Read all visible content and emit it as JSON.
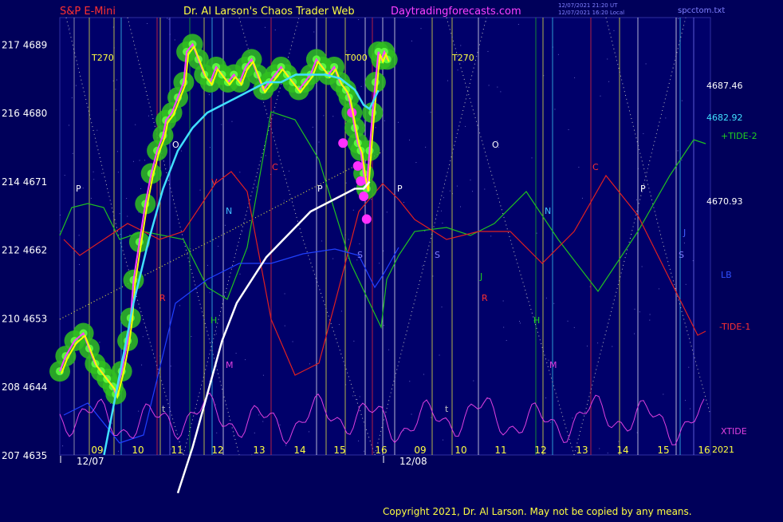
{
  "header": {
    "instrument": "S&P E-Mini",
    "site_title": "Dr. Al Larson's Chaos Trader Web",
    "site_url": "Daytradingforecasts.com",
    "timestamp_line1": "12/07/2021 21:20 UT",
    "timestamp_line2": "12/07/2021 16:20 Local",
    "file_name": "spcctom.txt"
  },
  "copyright": "Copyright 2021, Dr. Al Larson. May not be copied by any means.",
  "colors": {
    "background": "#00005a",
    "plot_bg": "#00006a",
    "header_red": "#ff3030",
    "header_yellow": "#ffff40",
    "header_magenta": "#ff40ff",
    "price": "#ffff00",
    "price_glow": "#30c020",
    "ma_cyan": "#40e0ff",
    "ma_white": "#ffffff",
    "tide_green": "#20c020",
    "tide_red": "#e02020",
    "lb_blue": "#2040ff",
    "xtide_magenta": "#e040e0"
  },
  "chart_data": {
    "type": "line",
    "x_labels": [
      "09",
      "10",
      "11",
      "12",
      "13",
      "14",
      "15",
      "16",
      "09",
      "10",
      "11",
      "12",
      "13",
      "14",
      "15",
      "16"
    ],
    "date_labels": [
      "12/07",
      "12/08"
    ],
    "y_ticks": [
      {
        "pair": "217 4689",
        "value": 4689
      },
      {
        "pair": "216 4680",
        "value": 4680
      },
      {
        "pair": "214 4671",
        "value": 4671
      },
      {
        "pair": "212 4662",
        "value": 4662
      },
      {
        "pair": "210 4653",
        "value": 4653
      },
      {
        "pair": "208 4644",
        "value": 4644
      },
      {
        "pair": "207 4635",
        "value": 4635
      }
    ],
    "ylim": [
      4635,
      4692.5
    ],
    "right_values": [
      {
        "label": "4687.46",
        "value": 4687.46,
        "color": "#ffffff"
      },
      {
        "label": "4682.92",
        "value": 4682.92,
        "color": "#40e0ff"
      },
      {
        "label": "4670.93",
        "value": 4670.93,
        "color": "#ffffff"
      }
    ],
    "legend_right": [
      {
        "label": "+TIDE-2",
        "color": "#20d020"
      },
      {
        "label": "LB",
        "color": "#3050ff"
      },
      {
        "label": "-TIDE-1",
        "color": "#ff3030"
      },
      {
        "label": "XTIDE",
        "color": "#e040e0"
      },
      {
        "label": "2021",
        "color": "#ffff40"
      }
    ],
    "markers": [
      {
        "text": "T270",
        "color": "#ffff40"
      },
      {
        "text": "T000",
        "color": "#ffff40"
      },
      {
        "text": "T270",
        "color": "#ffff40"
      },
      {
        "text": "P",
        "color": "#ffffff"
      },
      {
        "text": "O",
        "color": "#ffffff"
      },
      {
        "text": "P",
        "color": "#ffffff"
      },
      {
        "text": "P",
        "color": "#ffffff"
      },
      {
        "text": "O",
        "color": "#ffffff"
      },
      {
        "text": "P",
        "color": "#ffffff"
      },
      {
        "text": "C",
        "color": "#ff3030"
      },
      {
        "text": "C",
        "color": "#ff3030"
      },
      {
        "text": "V",
        "color": "#ff3030"
      },
      {
        "text": "R",
        "color": "#ff3030"
      },
      {
        "text": "R",
        "color": "#ff3030"
      },
      {
        "text": "N",
        "color": "#40c0ff"
      },
      {
        "text": "N",
        "color": "#40c0ff"
      },
      {
        "text": "S",
        "color": "#8080ff"
      },
      {
        "text": "S",
        "color": "#8080ff"
      },
      {
        "text": "S",
        "color": "#8080ff"
      },
      {
        "text": "H",
        "color": "#20d020"
      },
      {
        "text": "H",
        "color": "#20d020"
      },
      {
        "text": "J",
        "color": "#20d020"
      },
      {
        "text": "J",
        "color": "#4060ff"
      },
      {
        "text": "M",
        "color": "#e040e0"
      },
      {
        "text": "M",
        "color": "#e040e0"
      },
      {
        "text": "t",
        "color": "#c0c0c0"
      },
      {
        "text": "t",
        "color": "#c0c0c0"
      }
    ],
    "price_series": [
      [
        0,
        4646
      ],
      [
        2,
        4648
      ],
      [
        5,
        4650
      ],
      [
        8,
        4651
      ],
      [
        10,
        4649
      ],
      [
        12,
        4647
      ],
      [
        14,
        4646
      ],
      [
        16,
        4645
      ],
      [
        18,
        4644
      ],
      [
        19,
        4643
      ],
      [
        21,
        4646
      ],
      [
        23,
        4650
      ],
      [
        24,
        4653
      ],
      [
        25,
        4658
      ],
      [
        27,
        4663
      ],
      [
        29,
        4668
      ],
      [
        31,
        4672
      ],
      [
        33,
        4675
      ],
      [
        35,
        4677
      ],
      [
        36,
        4679
      ],
      [
        38,
        4680
      ],
      [
        40,
        4682
      ],
      [
        42,
        4684
      ],
      [
        43,
        4688
      ],
      [
        45,
        4689
      ],
      [
        47,
        4687
      ],
      [
        49,
        4685
      ],
      [
        51,
        4684
      ],
      [
        53,
        4686
      ],
      [
        55,
        4685
      ],
      [
        57,
        4684
      ],
      [
        59,
        4685
      ],
      [
        61,
        4684
      ],
      [
        63,
        4686
      ],
      [
        65,
        4687
      ],
      [
        67,
        4685
      ],
      [
        69,
        4683
      ],
      [
        71,
        4684
      ],
      [
        73,
        4685
      ],
      [
        75,
        4686
      ],
      [
        77,
        4685
      ],
      [
        79,
        4684
      ],
      [
        81,
        4683
      ],
      [
        83,
        4684
      ],
      [
        85,
        4685
      ],
      [
        87,
        4687
      ],
      [
        89,
        4686
      ],
      [
        91,
        4685
      ],
      [
        93,
        4686
      ],
      [
        95,
        4684
      ],
      [
        97,
        4683
      ],
      [
        98,
        4682
      ],
      [
        99,
        4680
      ],
      [
        100,
        4678
      ],
      [
        101,
        4676
      ],
      [
        102,
        4675
      ],
      [
        103,
        4672
      ],
      [
        104,
        4670
      ],
      [
        105,
        4675
      ],
      [
        106,
        4680
      ],
      [
        107,
        4684
      ],
      [
        108,
        4688
      ],
      [
        109,
        4687
      ],
      [
        110,
        4688
      ],
      [
        111,
        4687
      ]
    ],
    "ma_cyan": [
      [
        15,
        4635
      ],
      [
        20,
        4645
      ],
      [
        25,
        4655
      ],
      [
        30,
        4663
      ],
      [
        35,
        4670
      ],
      [
        40,
        4675
      ],
      [
        45,
        4678
      ],
      [
        50,
        4680
      ],
      [
        55,
        4681
      ],
      [
        60,
        4682
      ],
      [
        65,
        4683
      ],
      [
        70,
        4684
      ],
      [
        75,
        4684
      ],
      [
        80,
        4685
      ],
      [
        85,
        4685
      ],
      [
        90,
        4685
      ],
      [
        95,
        4684.5
      ],
      [
        100,
        4683
      ],
      [
        103,
        4681
      ],
      [
        105,
        4680.5
      ],
      [
        108,
        4682.92
      ]
    ],
    "ma_white": [
      [
        40,
        4630
      ],
      [
        45,
        4636
      ],
      [
        50,
        4643
      ],
      [
        55,
        4650
      ],
      [
        60,
        4655
      ],
      [
        65,
        4658
      ],
      [
        70,
        4661
      ],
      [
        75,
        4663
      ],
      [
        80,
        4665
      ],
      [
        85,
        4667
      ],
      [
        90,
        4668
      ],
      [
        95,
        4669
      ],
      [
        100,
        4670
      ],
      [
        103,
        4670
      ],
      [
        105,
        4670.93
      ]
    ]
  }
}
